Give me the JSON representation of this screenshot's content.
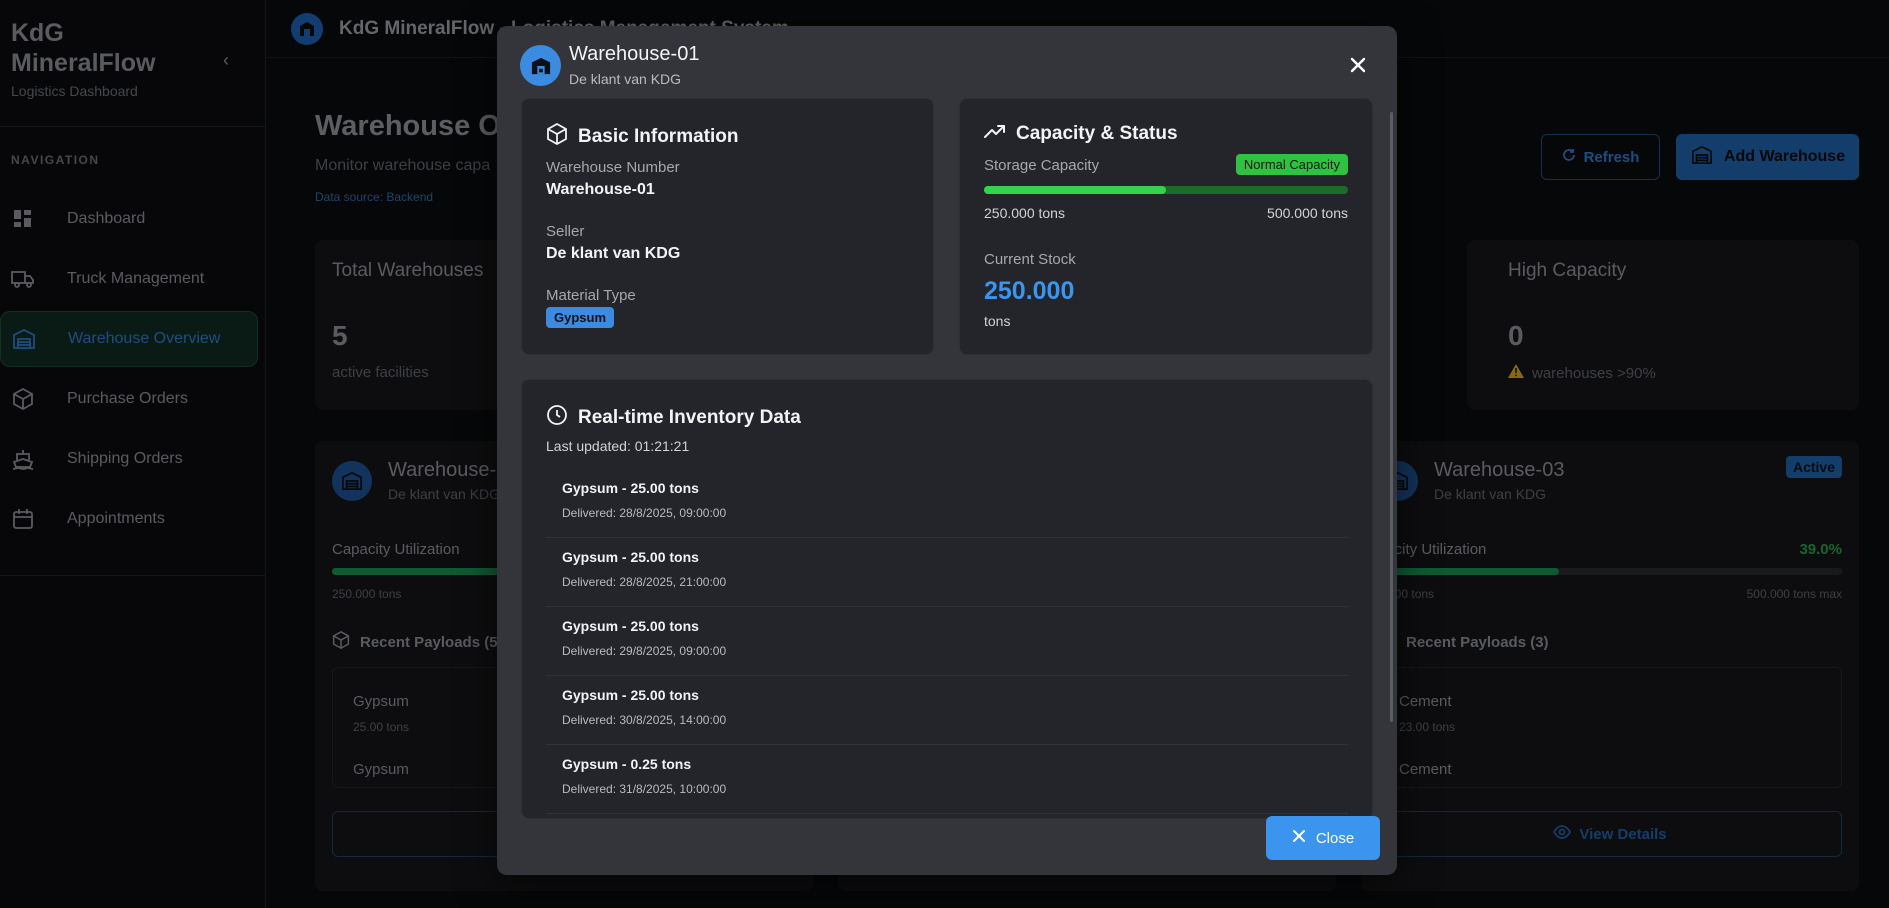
{
  "sidebar": {
    "brand_line1": "KdG",
    "brand_line2": "MineralFlow",
    "brand_sub": "Logistics Dashboard",
    "nav_heading": "NAVIGATION",
    "items": [
      {
        "label": "Dashboard"
      },
      {
        "label": "Truck Management"
      },
      {
        "label": "Warehouse Overview"
      },
      {
        "label": "Purchase Orders"
      },
      {
        "label": "Shipping Orders"
      },
      {
        "label": "Appointments"
      }
    ]
  },
  "topbar": {
    "title": "KdG MineralFlow - Logistics Management System"
  },
  "page": {
    "title": "Warehouse O",
    "subtitle": "Monitor warehouse capa",
    "source": "Data source: Backend",
    "refresh_label": "Refresh",
    "add_label": "Add Warehouse"
  },
  "stats": {
    "total": {
      "label": "Total Warehouses",
      "value": "5",
      "note": "active facilities"
    },
    "high": {
      "label": "High Capacity",
      "value": "0",
      "note": "warehouses >90%"
    }
  },
  "cards": {
    "left": {
      "name": "Warehouse-0",
      "seller": "De klant van KDG",
      "cap_label": "Capacity Utilization",
      "cap_min": "250.000 tons",
      "rp_label": "Recent Payloads (5)",
      "payload1_name": "Gypsum",
      "payload1_qty": "25.00 tons",
      "payload2_name": "Gypsum"
    },
    "right": {
      "name": "Warehouse-03",
      "seller": "De klant van KDG",
      "badge": "Active",
      "cap_label": "pacity Utilization",
      "cap_pct": "39.0%",
      "cap_fraction": 0.39,
      "cap_min": "0.000 tons",
      "cap_max": "500.000 tons max",
      "rp_label": "Recent Payloads (3)",
      "payload1_name": "Cement",
      "payload1_qty": "23.00 tons",
      "payload2_name": "Cement",
      "view_label": "View Details"
    }
  },
  "modal": {
    "title": "Warehouse-01",
    "subtitle": "De klant van KDG",
    "basic": {
      "title": "Basic Information",
      "number_label": "Warehouse Number",
      "number_value": "Warehouse-01",
      "seller_label": "Seller",
      "seller_value": "De klant van KDG",
      "material_label": "Material Type",
      "material_value": "Gypsum"
    },
    "capacity": {
      "title": "Capacity & Status",
      "storage_label": "Storage Capacity",
      "status": "Normal Capacity",
      "fill_fraction": 0.5,
      "current_tons": "250.000 tons",
      "max_tons": "500.000 tons",
      "stock_label": "Current Stock",
      "stock_value": "250.000",
      "stock_unit": "tons"
    },
    "inventory": {
      "title": "Real-time Inventory Data",
      "updated": "Last updated: 01:21:21",
      "items": [
        {
          "name": "Gypsum - 25.00 tons",
          "date": "Delivered: 28/8/2025, 09:00:00"
        },
        {
          "name": "Gypsum - 25.00 tons",
          "date": "Delivered: 28/8/2025, 21:00:00"
        },
        {
          "name": "Gypsum - 25.00 tons",
          "date": "Delivered: 29/8/2025, 09:00:00"
        },
        {
          "name": "Gypsum - 25.00 tons",
          "date": "Delivered: 30/8/2025, 14:00:00"
        },
        {
          "name": "Gypsum - 0.25 tons",
          "date": "Delivered: 31/8/2025, 10:00:00"
        }
      ]
    },
    "close_label": "Close"
  },
  "colors": {
    "accent": "#3b94ee",
    "success": "#33d34a",
    "warning": "#d4a017"
  }
}
